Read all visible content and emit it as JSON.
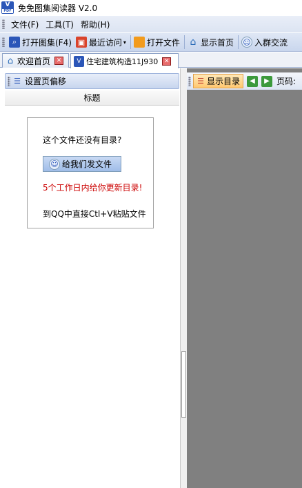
{
  "window": {
    "title": "免免图集阅读器 V2.0"
  },
  "menu": [
    {
      "label": "文件(F)"
    },
    {
      "label": "工具(T)"
    },
    {
      "label": "帮助(H)"
    }
  ],
  "toolbar": {
    "open_atlas": "打开图集(F4)",
    "recent": "最近访问",
    "open_file": "打开文件",
    "show_home": "显示首页",
    "join_group": "入群交流"
  },
  "tabs": [
    {
      "label": "欢迎首页"
    },
    {
      "label": "住宅建筑构造11J930"
    }
  ],
  "left_panel": {
    "set_offset": "设置页偏移",
    "column_title": "标题",
    "notice": {
      "question": "这个文件还没有目录?",
      "send_button": "给我们发文件",
      "promise": "5个工作日内给你更新目录!",
      "paste_hint": "到QQ中直接Ctl+V粘贴文件"
    }
  },
  "right_toolbar": {
    "show_toc": "显示目录",
    "page_label": "页码:"
  },
  "colors": {
    "accent": "#2b56b8",
    "promise_text": "#cc0000",
    "viewer_bg": "#808080"
  }
}
